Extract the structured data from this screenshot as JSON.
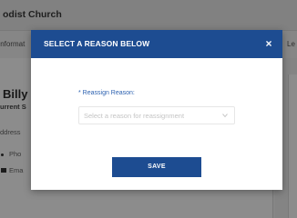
{
  "background": {
    "church_name": "odist Church",
    "tab_left": "Informat",
    "tab_right": "Le",
    "person_name": "Billy",
    "current_label": "urrent S",
    "address_label": "ddress",
    "phone_label": "Pho",
    "email_label": "Ema"
  },
  "modal": {
    "title": "SELECT A REASON BELOW",
    "close_symbol": "×",
    "field_label": "* Reassign Reason:",
    "select_placeholder": "Select a reason for reassignment",
    "save_label": "SAVE"
  },
  "colors": {
    "header_blue": "#1d4c91",
    "label_blue": "#2c61b0"
  }
}
